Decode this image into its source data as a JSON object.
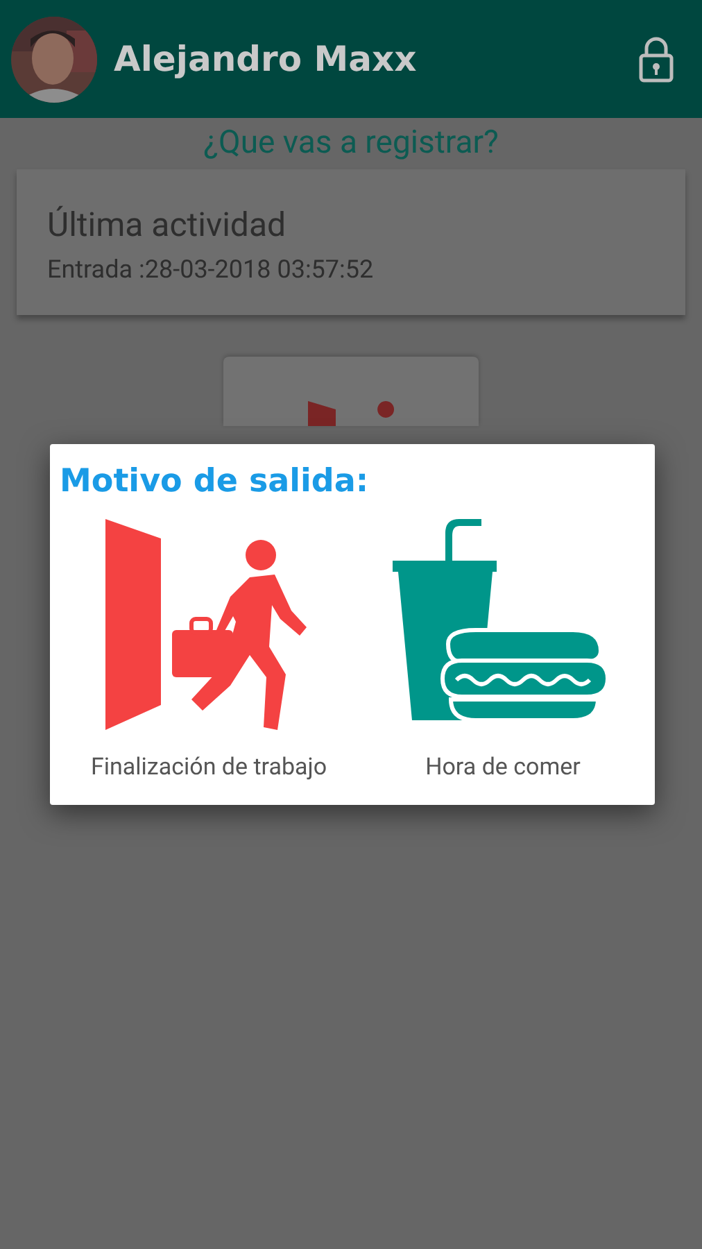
{
  "header": {
    "user_name": "Alejandro Maxx"
  },
  "prompt": "¿Que vas a registrar?",
  "last_activity": {
    "title": "Última actividad",
    "entry": "Entrada :28-03-2018 03:57:52"
  },
  "dialog": {
    "title": "Motivo de salida:",
    "options": [
      {
        "kind": "work",
        "label": "Finalización de trabajo"
      },
      {
        "kind": "meal",
        "label": "Hora de comer"
      }
    ]
  }
}
